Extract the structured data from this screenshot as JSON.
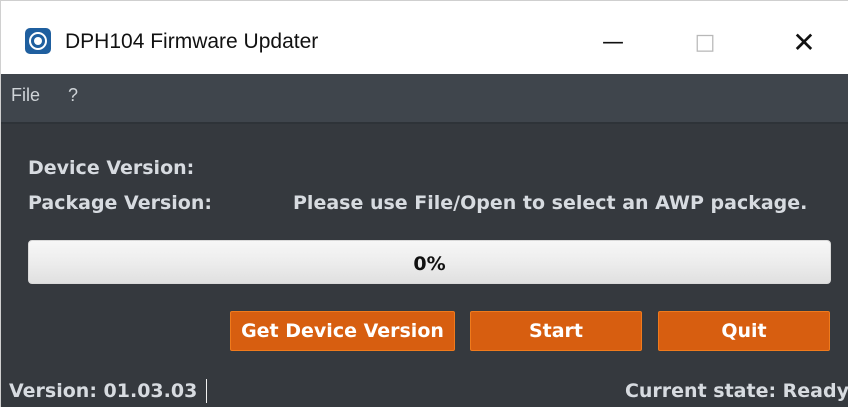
{
  "window": {
    "title": "DPH104 Firmware Updater",
    "controls": {
      "minimize": "—",
      "maximize": "□",
      "close": "✕"
    },
    "icon": "app-icon"
  },
  "menu": {
    "items": [
      {
        "label": "File"
      },
      {
        "label": "?"
      }
    ]
  },
  "labels": {
    "device_version": "Device Version:",
    "package_version": "Package Version:",
    "package_message": "Please use File/Open to select an AWP package."
  },
  "progress": {
    "value": 0,
    "label": "0%"
  },
  "buttons": {
    "get_device_version": "Get Device Version",
    "start": "Start",
    "quit": "Quit"
  },
  "status": {
    "version": "Version: 01.03.03",
    "current_state": "Current state: Ready"
  },
  "colors": {
    "menu_background": "#3f454c",
    "content_background": "#35393e",
    "accent": "#d75e10",
    "text": "#d7dbe0"
  }
}
